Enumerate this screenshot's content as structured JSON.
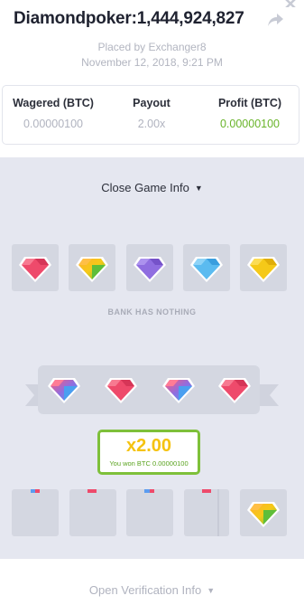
{
  "header": {
    "title": "Diamondpoker:1,444,924,827",
    "placed_by": "Placed by Exchanger8",
    "timestamp": "November 12, 2018, 9:21 PM",
    "share_icon": "share-arrow-icon",
    "close_icon": "close-icon"
  },
  "stats": {
    "wagered_label": "Wagered (BTC)",
    "wagered_value": "0.00000100",
    "payout_label": "Payout",
    "payout_value": "2.00x",
    "profit_label": "Profit (BTC)",
    "profit_value": "0.00000100"
  },
  "game": {
    "close_info_label": "Close Game Info",
    "chevron_icon": "chevron-down-icon",
    "bank_gems": [
      "red",
      "yellow-green",
      "purple",
      "blue",
      "yellow"
    ],
    "bank_status": "BANK HAS NOTHING",
    "player_gems": [
      "purple-blue",
      "red",
      "purple-blue",
      "red"
    ],
    "multiplier": "x2.00",
    "won_text": "You won BTC 0.00000100",
    "bottom_slots": [
      "empty",
      "empty",
      "empty",
      "empty",
      "yellow-green"
    ],
    "verify_label": "Open Verification Info"
  },
  "colors": {
    "red": "#ee4a6b",
    "yellow-green": "#9ccc3a",
    "purple": "#8f6de0",
    "blue": "#5bbbf0",
    "yellow": "#f5c918",
    "profit_green": "#69b42a",
    "result_border": "#7ec03a",
    "multiplier_yellow": "#f5c311"
  }
}
